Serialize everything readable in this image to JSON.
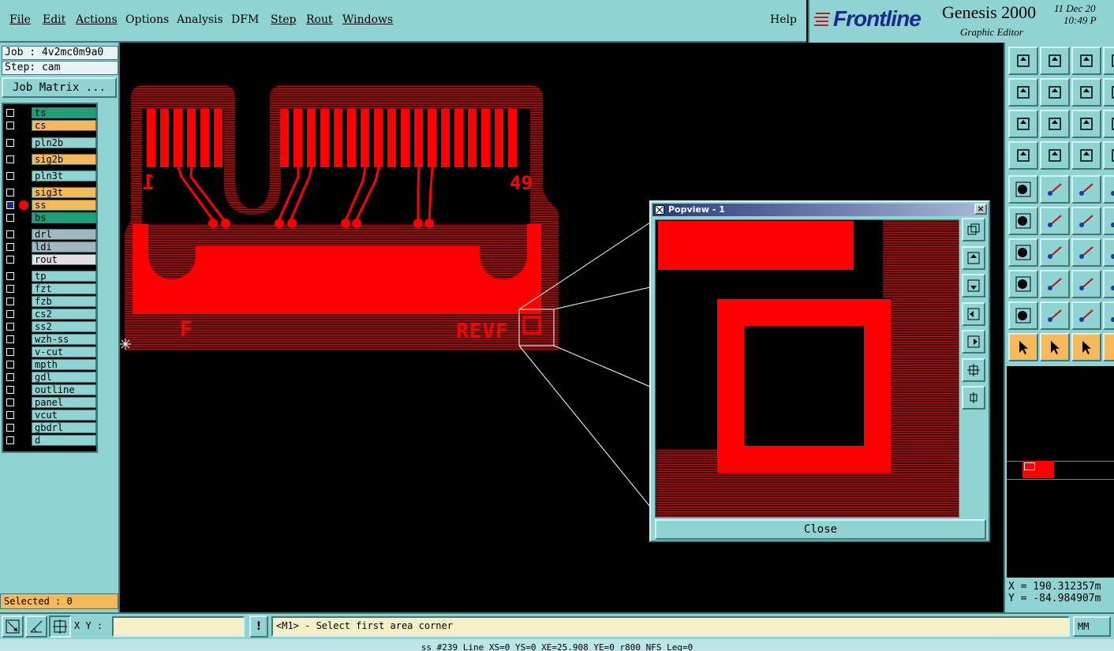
{
  "menu": {
    "items": [
      "File",
      "Edit",
      "Actions",
      "Options",
      "Analysis",
      "DFM",
      "Step",
      "Rout",
      "Windows"
    ],
    "help": "Help"
  },
  "brand": {
    "logo": "Frontline",
    "product": "Genesis 2000",
    "subtitle": "Graphic Editor",
    "date": "11 Dec 20",
    "time": "10:49 P"
  },
  "job": {
    "job_line": "Job : 4v2mc0m9a0",
    "step_line": "Step: cam",
    "matrix_button": "Job Matrix ..."
  },
  "layers": [
    {
      "name": "ts",
      "color": "#1f9e7a"
    },
    {
      "name": "cs",
      "color": "#f5b85a"
    },
    {
      "name": "pln2b",
      "color": "#8fd3d3"
    },
    {
      "name": "sig2b",
      "color": "#f5b85a"
    },
    {
      "name": "pln3t",
      "color": "#8fd3d3"
    },
    {
      "name": "sig3t",
      "color": "#f5b85a"
    },
    {
      "name": "ss",
      "color": "#f5b85a"
    },
    {
      "name": "bs",
      "color": "#1f9e7a"
    },
    {
      "name": "drl",
      "color": "#a0b8c0"
    },
    {
      "name": "ldi",
      "color": "#a0b8c0"
    },
    {
      "name": "rout",
      "color": "#e0e0e0"
    },
    {
      "name": "tp",
      "color": "#8fd3d3"
    },
    {
      "name": "fzt",
      "color": "#8fd3d3"
    },
    {
      "name": "fzb",
      "color": "#8fd3d3"
    },
    {
      "name": "cs2",
      "color": "#8fd3d3"
    },
    {
      "name": "ss2",
      "color": "#8fd3d3"
    },
    {
      "name": "wzh-ss",
      "color": "#8fd3d3"
    },
    {
      "name": "v-cut",
      "color": "#8fd3d3"
    },
    {
      "name": "mpth",
      "color": "#8fd3d3"
    },
    {
      "name": "gdl",
      "color": "#8fd3d3"
    },
    {
      "name": "outline",
      "color": "#8fd3d3"
    },
    {
      "name": "panel",
      "color": "#8fd3d3"
    },
    {
      "name": "vcut",
      "color": "#8fd3d3"
    },
    {
      "name": "gbdrl",
      "color": "#8fd3d3"
    },
    {
      "name": "d",
      "color": "#8fd3d3"
    }
  ],
  "selected": "Selected : 0",
  "pcb_labels": {
    "left_num": "1",
    "right_num": "49",
    "left_letter": "F",
    "right_text": "REVF"
  },
  "popview": {
    "title": "Popview - 1",
    "close_label": "Close"
  },
  "coords": {
    "x": "X = 190.312357m",
    "y": "Y = -84.984907m"
  },
  "bottom": {
    "xy_label": "X Y :",
    "xy_value": "",
    "prompt": "<M1> - Select first area corner",
    "units": "MM"
  },
  "status": "ss #239 Line XS=0 YS=0 XE=25.908 YE=0 r800 NFS Leg=0",
  "colors": {
    "panel": "#8fd3d3",
    "copper": "#ff0000",
    "highlight": "#f5b85a"
  }
}
